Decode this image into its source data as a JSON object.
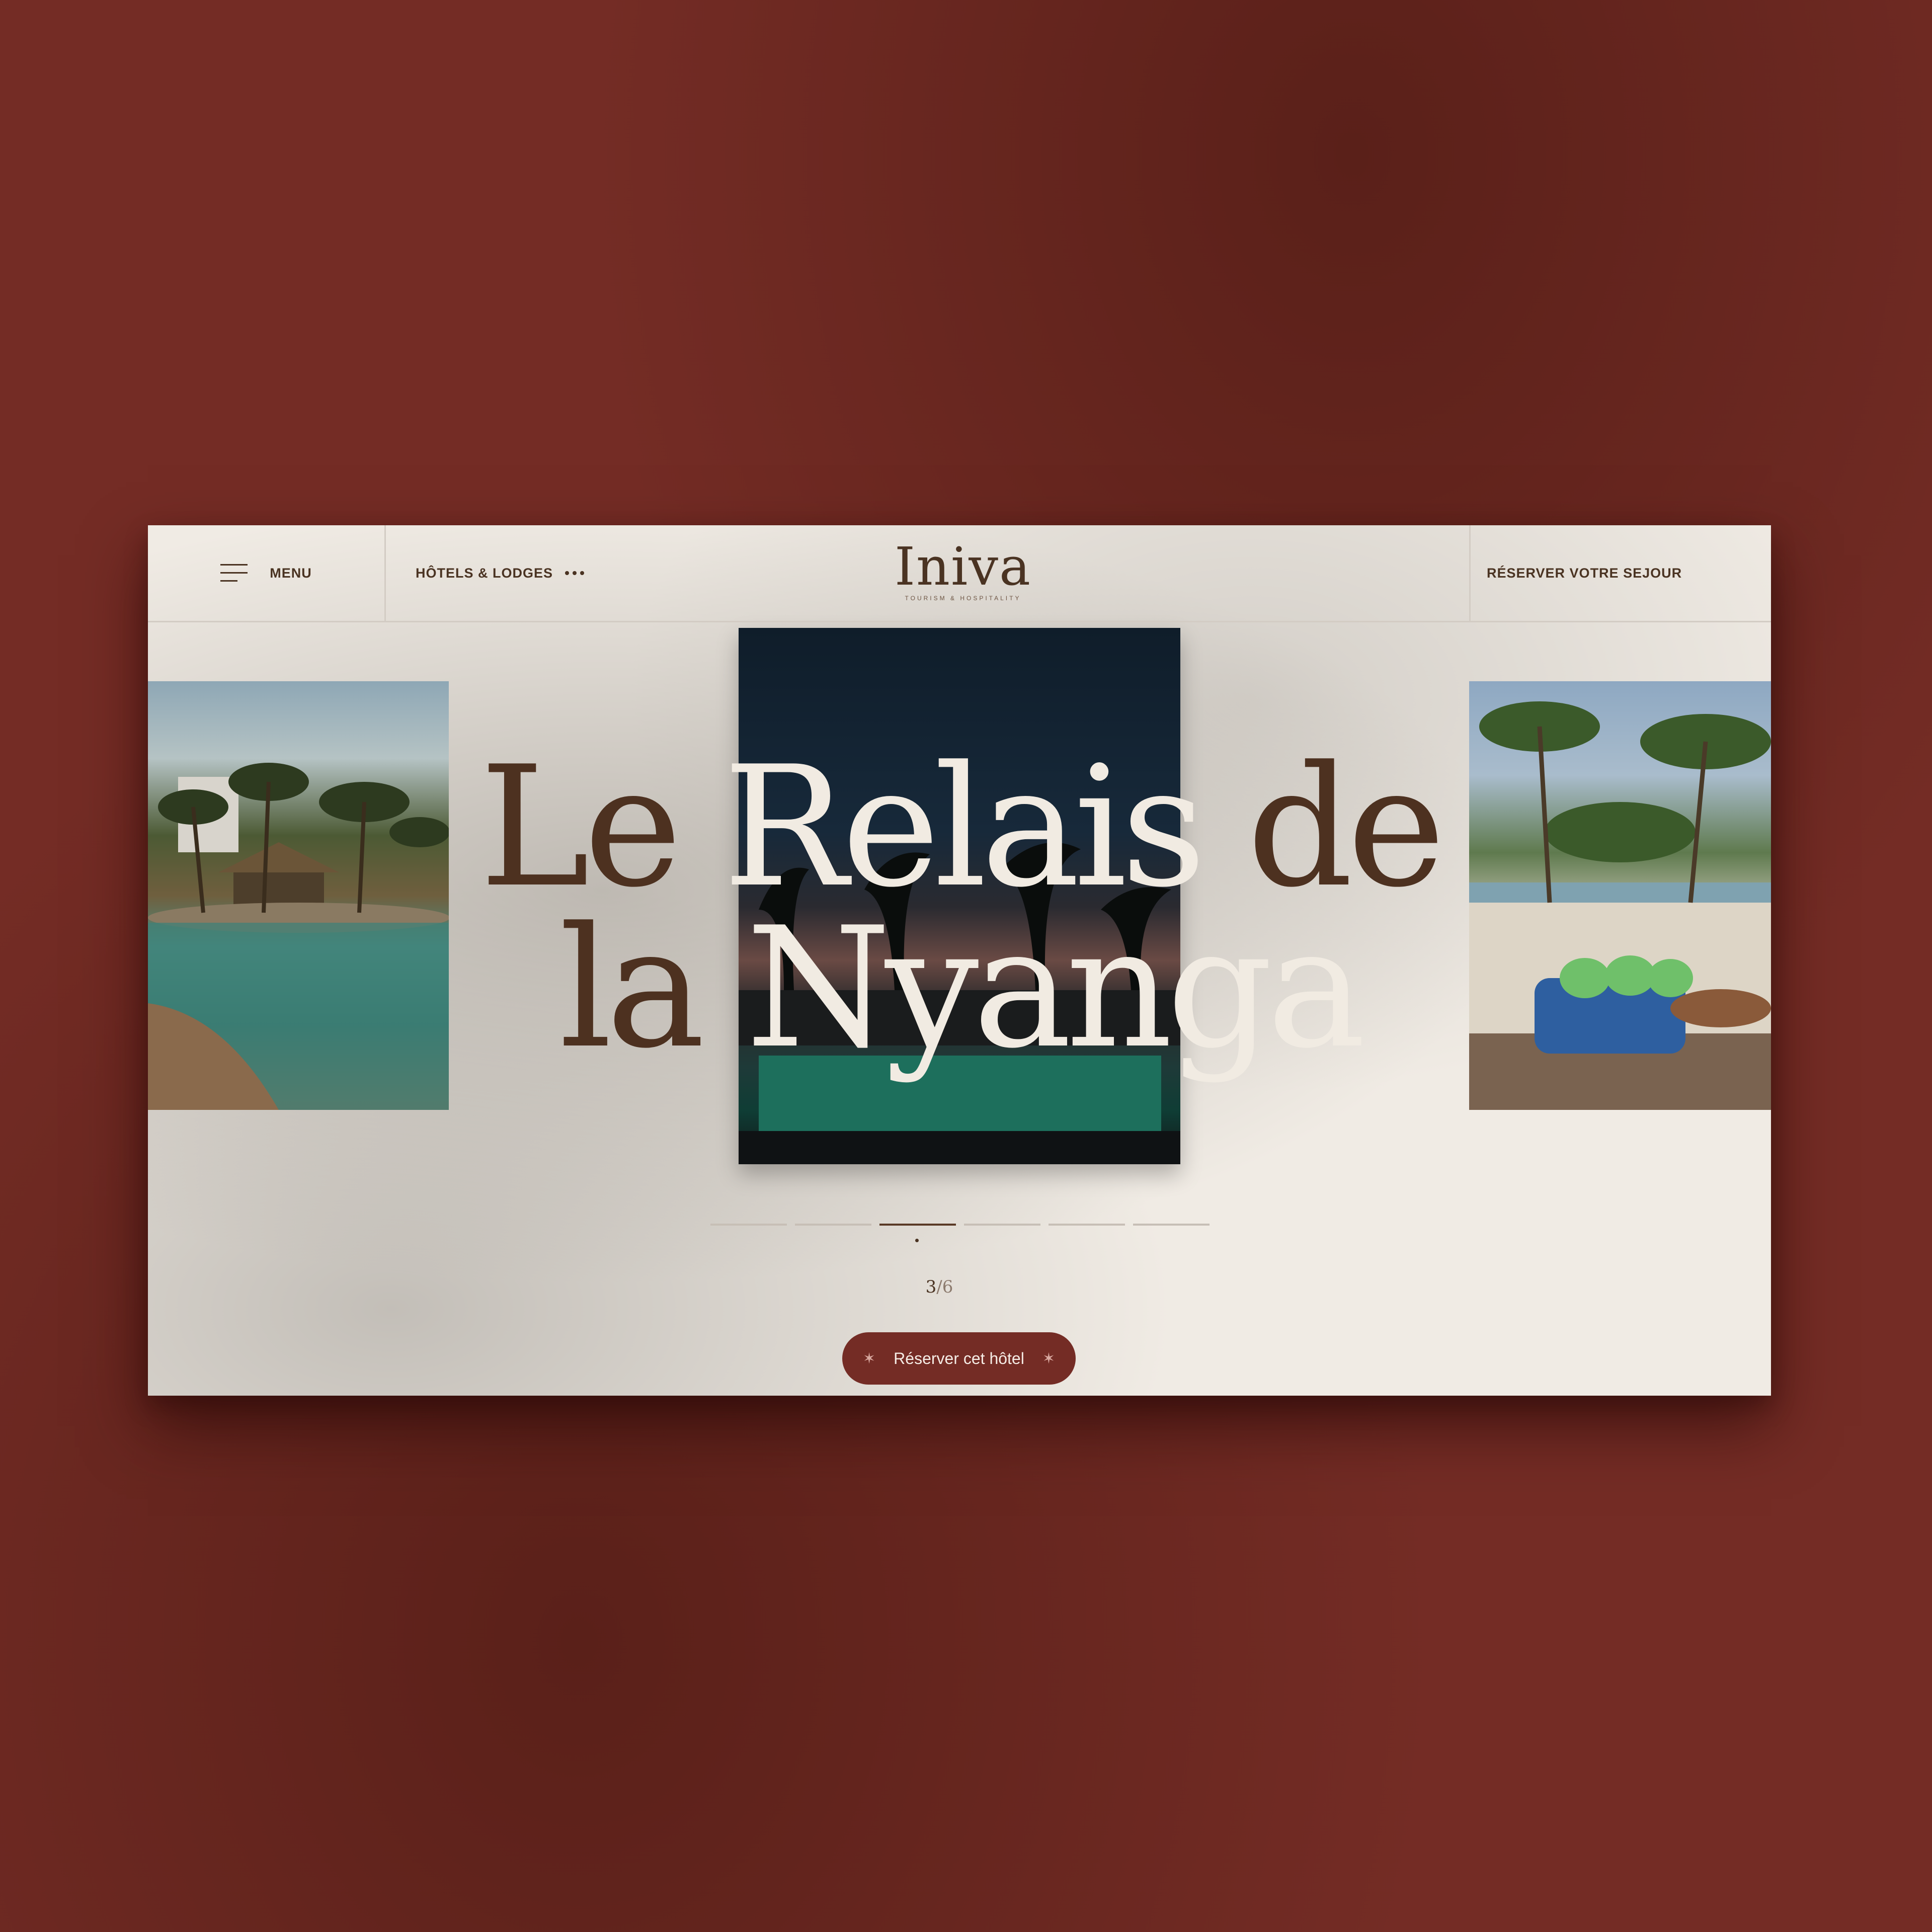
{
  "header": {
    "menu_label": "MENU",
    "hotels_label": "HÔTELS & LODGES",
    "logo_word": "Iniva",
    "logo_tagline": "TOURISM & HOSPITALITY",
    "reserve_label": "RÉSERVER VOTRE SEJOUR"
  },
  "slider": {
    "title_line1": [
      "Le ",
      "Relais",
      " de"
    ],
    "title_line2": [
      "la",
      " Nyanga"
    ],
    "current": "3",
    "separator": "/",
    "total": "6",
    "active_index": 3,
    "segment_count": 6
  },
  "cta": {
    "label": "Réserver cet hôtel"
  },
  "icons": {
    "menu": "hamburger-icon",
    "more": "more-dots-icon",
    "cta_left": "sparkle-icon",
    "cta_right": "sparkle-icon"
  },
  "colors": {
    "page_background": "#742c25",
    "panel_background": "#f0ebe4",
    "text_brown": "#4a3322",
    "button": "#742c25"
  }
}
